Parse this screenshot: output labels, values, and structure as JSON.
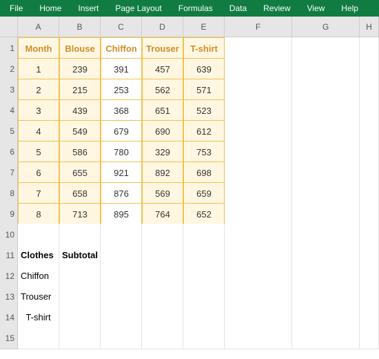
{
  "ribbon": {
    "tabs": [
      "File",
      "Home",
      "Insert",
      "Page Layout",
      "Formulas",
      "Data",
      "Review",
      "View",
      "Help"
    ]
  },
  "cols": [
    "A",
    "B",
    "C",
    "D",
    "E",
    "F",
    "G",
    "H"
  ],
  "rows": [
    "1",
    "2",
    "3",
    "4",
    "5",
    "6",
    "7",
    "8",
    "9",
    "10",
    "11",
    "12",
    "13",
    "14",
    "15"
  ],
  "headers": [
    "Month",
    "Blouse",
    "Chiffon",
    "Trouser",
    "T-shirt"
  ],
  "data": [
    [
      "1",
      "239",
      "391",
      "457",
      "639"
    ],
    [
      "2",
      "215",
      "253",
      "562",
      "571"
    ],
    [
      "3",
      "439",
      "368",
      "651",
      "523"
    ],
    [
      "4",
      "549",
      "679",
      "690",
      "612"
    ],
    [
      "5",
      "586",
      "780",
      "329",
      "753"
    ],
    [
      "6",
      "655",
      "921",
      "892",
      "698"
    ],
    [
      "7",
      "658",
      "876",
      "569",
      "659"
    ],
    [
      "8",
      "713",
      "895",
      "764",
      "652"
    ]
  ],
  "sub": {
    "hClothes": "Clothes",
    "hSubtotal": "Subtotal",
    "items": [
      "Chiffon",
      "Trouser",
      "T-shirt"
    ]
  },
  "chart_data": {
    "type": "table",
    "title": "",
    "categories": [
      "1",
      "2",
      "3",
      "4",
      "5",
      "6",
      "7",
      "8"
    ],
    "series": [
      {
        "name": "Blouse",
        "values": [
          239,
          215,
          439,
          549,
          586,
          655,
          658,
          713
        ]
      },
      {
        "name": "Chiffon",
        "values": [
          391,
          253,
          368,
          679,
          780,
          921,
          876,
          895
        ]
      },
      {
        "name": "Trouser",
        "values": [
          457,
          562,
          651,
          690,
          329,
          892,
          569,
          764
        ]
      },
      {
        "name": "T-shirt",
        "values": [
          639,
          571,
          523,
          612,
          753,
          698,
          659,
          652
        ]
      }
    ],
    "xlabel": "Month",
    "ylabel": ""
  }
}
